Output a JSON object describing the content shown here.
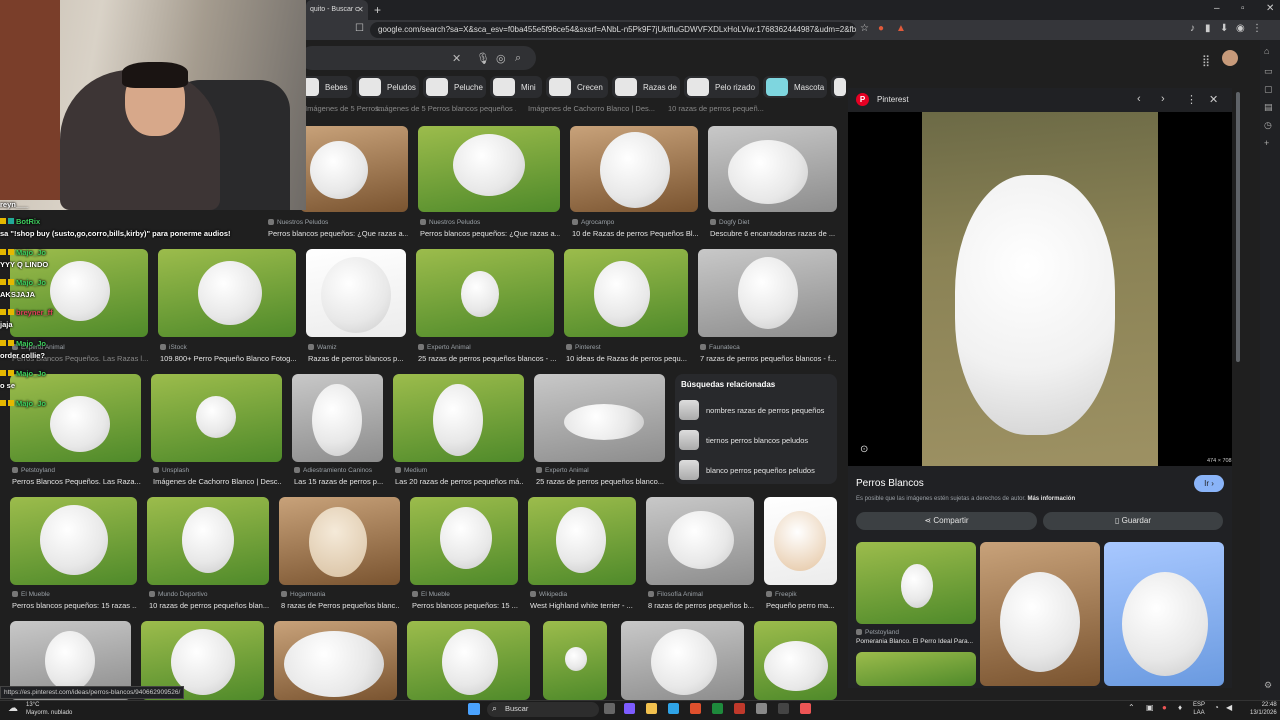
{
  "browser": {
    "tab_title": "quito - Buscar c",
    "url": "google.com/search?sa=X&sca_esv=f0ba455e5f96ce54&sxsrf=ANbL-n5Pk9F7jUktfluGDWVFXDLxHoLViw:1768362444987&udm=2&fbs=ADc_l-bpk8..."
  },
  "chips": [
    "Bebes",
    "Peludos",
    "Peluche",
    "Mini",
    "Crecen",
    "Razas de",
    "Pelo rizado",
    "Mascota"
  ],
  "results": [
    {
      "source": "Nuestros Peludos",
      "title": "Perros blancos pequeños: ¿Que razas a..."
    },
    {
      "source": "Nuestros Peludos",
      "title": "Perros blancos pequeños: ¿Que razas a..."
    },
    {
      "source": "Agrocampo",
      "title": "10 de Razas de perros Pequeños Bl..."
    },
    {
      "source": "Dogfy Diet",
      "title": "Descubre 6 encantadoras razas de ..."
    },
    {
      "source": "Experto Animal",
      "title": "blanco..."
    },
    {
      "source": "iStock",
      "title": "109.800+ Perro Pequeño Blanco Fotog..."
    },
    {
      "source": "Wamiz",
      "title": "Razas de perros blancos p..."
    },
    {
      "source": "Experto Animal",
      "title": "25 razas de perros pequeños blancos - ..."
    },
    {
      "source": "Pinterest",
      "title": "10 ideas de Razas de perros pequ..."
    },
    {
      "source": "Faunateca",
      "title": "7 razas de perros pequeños blancos - f..."
    },
    {
      "source": "Petstoyland",
      "title": "Perros Blancos Pequeños. Las Raza..."
    },
    {
      "source": "Unsplash",
      "title": "Imágenes de Cachorro Blanco | Desc..."
    },
    {
      "source": "Adiestramiento Caninos",
      "title": "Las 15 razas de perros p..."
    },
    {
      "source": "Medium",
      "title": "Las 20 razas de perros pequeños má..."
    },
    {
      "source": "Experto Animal",
      "title": "25 razas de perros pequeños blanco..."
    },
    {
      "source": "El Mueble",
      "title": "Perros blancos pequeños: 15 razas ..."
    },
    {
      "source": "Mundo Deportivo",
      "title": "10 razas de perros pequeños blan..."
    },
    {
      "source": "Hogarmania",
      "title": "8 razas de Perros pequeños blanc..."
    },
    {
      "source": "El Mueble",
      "title": "Perros blancos pequeños: 15 ..."
    },
    {
      "source": "Wikipedia",
      "title": "West Highland white terrier - ..."
    },
    {
      "source": "Filosofía Animal",
      "title": "8 razas de perros pequeños b..."
    },
    {
      "source": "Freepik",
      "title": "Pequeño perro ma..."
    }
  ],
  "top_row_titles": [
    "Imágenes de 5 Perros blancos pequeños ...",
    "Imágenes de Cachorro Blanco | Des...",
    "10 razas de perros pequeñ..."
  ],
  "related": {
    "title": "Búsquedas relacionadas",
    "items": [
      "nombres razas de perros pequeños",
      "tiernos perros blancos peludos",
      "blanco perros pequeños peludos"
    ]
  },
  "preview": {
    "site": "Pinterest",
    "title": "Perros Blancos",
    "go_label": "Ir",
    "copyright": "Es posible que las imágenes estén sujetas a derechos de autor.",
    "more_info": "Más información",
    "share_label": "Compartir",
    "save_label": "Guardar",
    "dimensions": "474 × 708",
    "related_source": "Petstoyland",
    "related_title": "Pomerania Blanco. El Perro Ideal Para..."
  },
  "status_url": "https://es.pinterest.com/ideas/perros-blancos/940662909526/",
  "chat": [
    {
      "name": "",
      "msg": "reyn___"
    },
    {
      "name": "BotRix",
      "msg": ""
    },
    {
      "name": "",
      "msg": "sa \"!shop buy (susto,go,corro,bills,kirby)\" para ponerme audios!"
    },
    {
      "name": "Majo_Jo",
      "msg": ""
    },
    {
      "name": "",
      "msg": "YYY Q LINDO"
    },
    {
      "name": "Majo_Jo",
      "msg": ""
    },
    {
      "name": "",
      "msg": "AKSJAJA"
    },
    {
      "name": "breyner_ff",
      "msg": ""
    },
    {
      "name": "",
      "msg": "jaja"
    },
    {
      "name": "Majo_Jo",
      "msg": ""
    },
    {
      "name": "",
      "msg": "order collie?"
    },
    {
      "name": "Majo_Jo",
      "msg": ""
    },
    {
      "name": "",
      "msg": "o se"
    },
    {
      "name": "Majo_Jo",
      "msg": ""
    }
  ],
  "taskbar": {
    "temp": "13°C",
    "weather": "Mayorm. nublado",
    "search": "Buscar",
    "lang1": "ESP",
    "lang2": "LAA",
    "time": "22:48",
    "date": "13/1/2026"
  },
  "colors": {
    "accent": "#8ab4f8",
    "chat_name": "#3ecf5e",
    "pinterest": "#e60023"
  }
}
